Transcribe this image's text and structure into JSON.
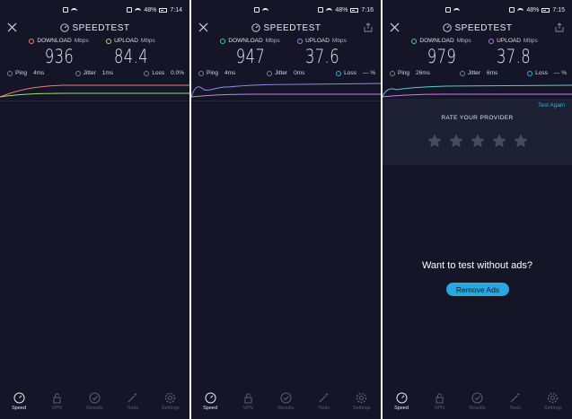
{
  "screens": [
    {
      "status": {
        "time": "7:14",
        "battery": "48%"
      },
      "header": {
        "title": "SPEEDTEST"
      },
      "download": {
        "label": "DOWNLOAD",
        "unit": "Mbps",
        "value": "936"
      },
      "upload": {
        "label": "UPLOAD",
        "unit": "Mbps",
        "value": "84.4"
      },
      "stats": [
        {
          "label": "Ping",
          "value": "4ms"
        },
        {
          "label": "Jitter",
          "value": "1ms"
        },
        {
          "label": "Loss",
          "value": "0.0%"
        }
      ]
    },
    {
      "status": {
        "time": "7:16",
        "battery": "48%"
      },
      "header": {
        "title": "SPEEDTEST"
      },
      "download": {
        "label": "DOWNLOAD",
        "unit": "Mbps",
        "value": "947"
      },
      "upload": {
        "label": "UPLOAD",
        "unit": "Mbps",
        "value": "37.6"
      },
      "stats": [
        {
          "label": "Ping",
          "value": "4ms"
        },
        {
          "label": "Jitter",
          "value": "0ms"
        },
        {
          "label": "Loss",
          "value": "— %"
        }
      ]
    },
    {
      "status": {
        "time": "7:15",
        "battery": "48%"
      },
      "header": {
        "title": "SPEEDTEST"
      },
      "download": {
        "label": "DOWNLOAD",
        "unit": "Mbps",
        "value": "979"
      },
      "upload": {
        "label": "UPLOAD",
        "unit": "Mbps",
        "value": "37.8"
      },
      "stats": [
        {
          "label": "Ping",
          "value": "26ms"
        },
        {
          "label": "Jitter",
          "value": "6ms"
        },
        {
          "label": "Loss",
          "value": "— %"
        }
      ],
      "result": {
        "test_again": "Test Again",
        "rate_title": "RATE YOUR PROVIDER",
        "ads_title": "Want to test without ads?",
        "remove_ads": "Remove Ads"
      }
    }
  ],
  "tabs": [
    {
      "label": "Speed",
      "icon": "speed-gauge-icon"
    },
    {
      "label": "VPN",
      "icon": "lock-icon"
    },
    {
      "label": "Results",
      "icon": "check-circle-icon"
    },
    {
      "label": "Tools",
      "icon": "wand-icon"
    },
    {
      "label": "Settings",
      "icon": "gear-icon"
    }
  ],
  "colors": {
    "background": "#141526",
    "card": "#1e2034",
    "accent": "#2fb0e8",
    "download_line": "#f07a7a",
    "upload_line": "#9be07a"
  }
}
